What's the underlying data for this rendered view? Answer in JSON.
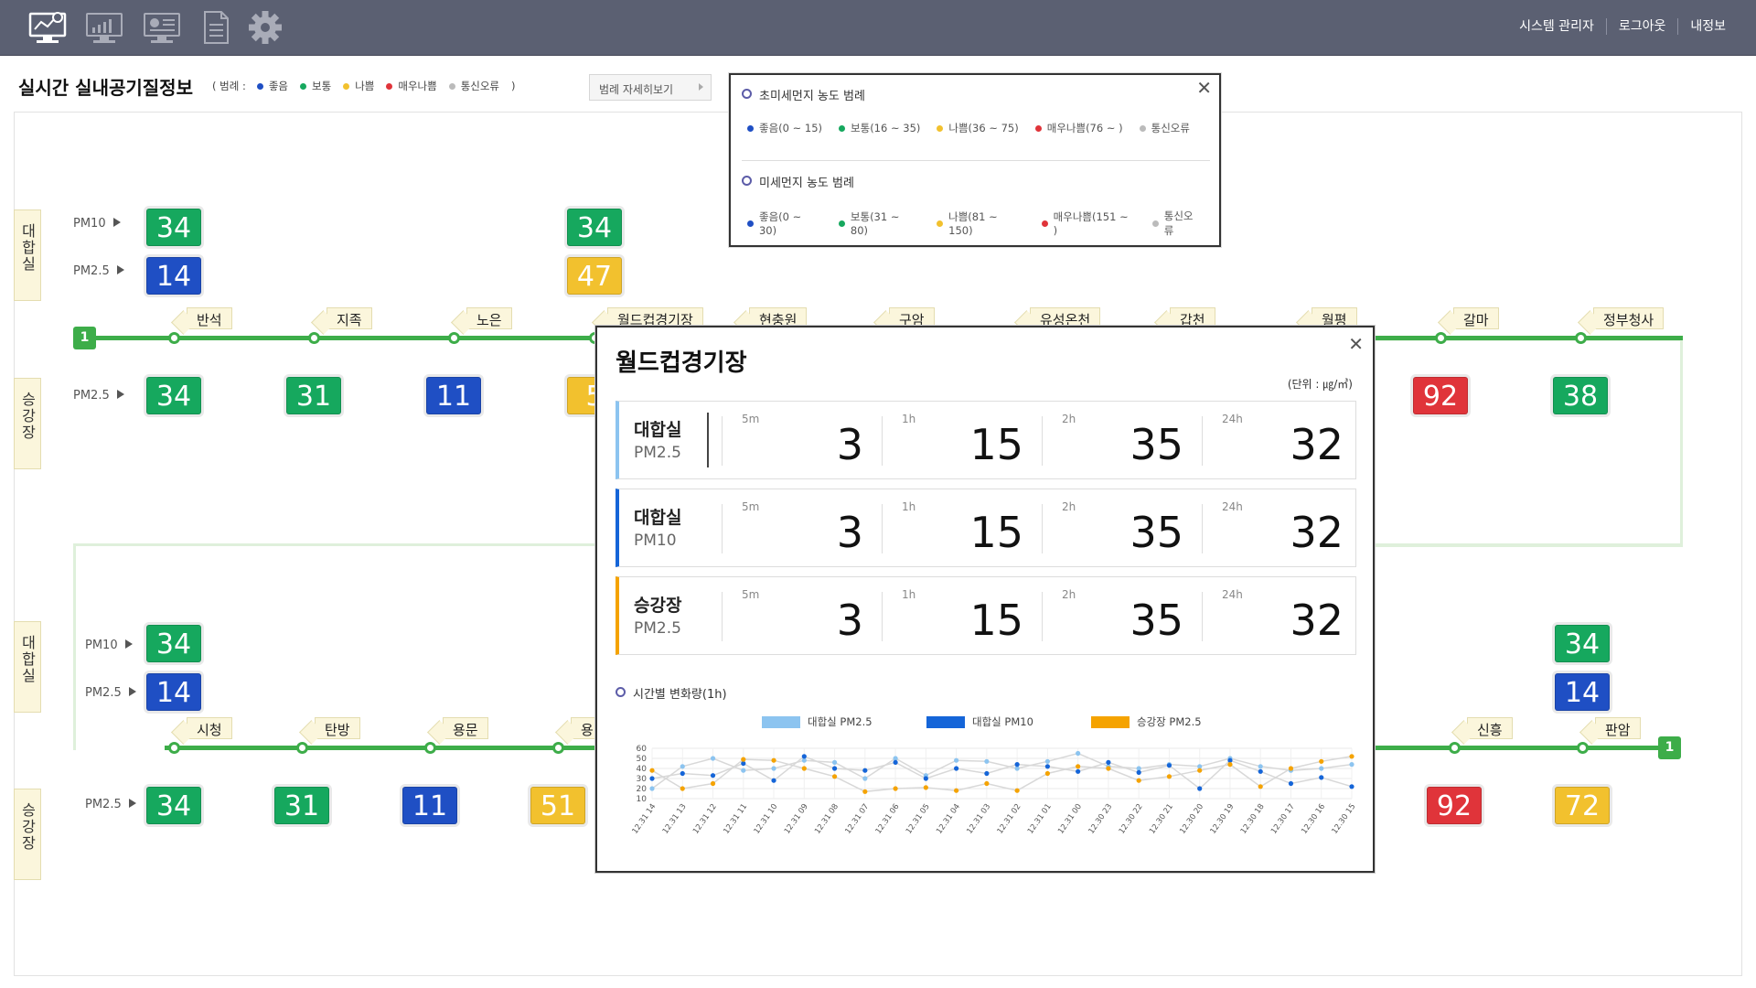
{
  "header": {
    "icons": [
      "monitor-dashboard-icon",
      "chart-monitor-icon",
      "presentation-monitor-icon",
      "document-icon",
      "gear-icon"
    ],
    "nav": [
      "시스템 관리자",
      "로그아웃",
      "내정보"
    ]
  },
  "page": {
    "title": "실시간 실내공기질정보",
    "legend_prefix": "( 범례 :",
    "legend_suffix": ")",
    "legend": [
      {
        "label": "좋음",
        "color": "#1f4fc4"
      },
      {
        "label": "보통",
        "color": "#16a85e"
      },
      {
        "label": "나쁨",
        "color": "#f2c12e"
      },
      {
        "label": "매우나쁨",
        "color": "#e0343a"
      },
      {
        "label": "통신오류",
        "color": "#bbbbbb"
      }
    ],
    "legend_button": "범례 자세히보기"
  },
  "side_tabs": {
    "daehapsil": "대합실",
    "seunggangjang": "승강장"
  },
  "row_labels": {
    "pm10": "PM10",
    "pm25": "PM2.5"
  },
  "line_number": "1",
  "upper_line": {
    "stations": [
      "반석",
      "지족",
      "노은",
      "월드컵경기장",
      "현충원",
      "구암",
      "유성온천",
      "갑천",
      "월평",
      "갈마",
      "정부청사"
    ],
    "concourse_pm10": [
      {
        "station": "반석",
        "value": "34",
        "color": "#16a85e"
      },
      {
        "station": "월드컵경기장",
        "value": "34",
        "color": "#16a85e"
      }
    ],
    "concourse_pm25": [
      {
        "station": "반석",
        "value": "14",
        "color": "#1f4fc4"
      },
      {
        "station": "월드컵경기장",
        "value": "47",
        "color": "#f2c12e"
      }
    ],
    "platform_pm25": [
      {
        "station": "반석",
        "value": "34",
        "color": "#16a85e"
      },
      {
        "station": "지족",
        "value": "31",
        "color": "#16a85e"
      },
      {
        "station": "노은",
        "value": "11",
        "color": "#1f4fc4"
      },
      {
        "station": "월드컵경기장",
        "value": "5",
        "color": "#f2c12e"
      },
      {
        "station": "갈마",
        "value": "92",
        "color": "#e0343a"
      },
      {
        "station": "정부청사",
        "value": "38",
        "color": "#16a85e"
      }
    ]
  },
  "lower_line": {
    "stations": [
      "시청",
      "탄방",
      "용문",
      "용",
      "신흥",
      "판암"
    ],
    "concourse_pm10": [
      {
        "station": "시청",
        "value": "34",
        "color": "#16a85e"
      },
      {
        "station": "판암",
        "value": "34",
        "color": "#16a85e"
      }
    ],
    "concourse_pm25": [
      {
        "station": "시청",
        "value": "14",
        "color": "#1f4fc4"
      },
      {
        "station": "판암",
        "value": "14",
        "color": "#1f4fc4"
      }
    ],
    "platform_pm25": [
      {
        "station": "시청",
        "value": "34",
        "color": "#16a85e"
      },
      {
        "station": "탄방",
        "value": "31",
        "color": "#16a85e"
      },
      {
        "station": "용문",
        "value": "11",
        "color": "#1f4fc4"
      },
      {
        "station": "용",
        "value": "51",
        "color": "#f2c12e"
      },
      {
        "station": "신흥",
        "value": "92",
        "color": "#e0343a"
      },
      {
        "station": "판암",
        "value": "72",
        "color": "#f2c12e"
      }
    ]
  },
  "legend_popup": {
    "pm25_title": "초미세먼지 농도 범례",
    "pm25_items": [
      {
        "label": "좋음(0 ~ 15)",
        "color": "#1f4fc4"
      },
      {
        "label": "보통(16 ~ 35)",
        "color": "#16a85e"
      },
      {
        "label": "나쁨(36 ~ 75)",
        "color": "#f2c12e"
      },
      {
        "label": "매우나쁨(76 ~ )",
        "color": "#e0343a"
      },
      {
        "label": "통신오류",
        "color": "#bbbbbb"
      }
    ],
    "pm10_title": "미세먼지 농도 범례",
    "pm10_items": [
      {
        "label": "좋음(0 ~ 30)",
        "color": "#1f4fc4"
      },
      {
        "label": "보통(31 ~ 80)",
        "color": "#16a85e"
      },
      {
        "label": "나쁨(81 ~ 150)",
        "color": "#f2c12e"
      },
      {
        "label": "매우나쁨(151 ~ )",
        "color": "#e0343a"
      },
      {
        "label": "통신오류",
        "color": "#bbbbbb"
      }
    ]
  },
  "detail_popup": {
    "title": "월드컵경기장",
    "unit": "(단위 : ㎍/㎥)",
    "periods": [
      "5m",
      "1h",
      "2h",
      "24h"
    ],
    "cards": [
      {
        "name": "대합실",
        "metric": "PM2.5",
        "accent": "#8cc4f0",
        "values": [
          "3",
          "15",
          "35",
          "32"
        ]
      },
      {
        "name": "대합실",
        "metric": "PM10",
        "accent": "#1565d8",
        "values": [
          "3",
          "15",
          "35",
          "32"
        ]
      },
      {
        "name": "승강장",
        "metric": "PM2.5",
        "accent": "#f5a300",
        "values": [
          "3",
          "15",
          "35",
          "32"
        ]
      }
    ],
    "chart_title": "시간별 변화량(1h)"
  },
  "chart_data": {
    "type": "line",
    "title": "시간별 변화량(1h)",
    "x": [
      "12.31 14",
      "12.31 13",
      "12.31 12",
      "12.31 11",
      "12.31 10",
      "12.31 09",
      "12.31 08",
      "12.31 07",
      "12.31 06",
      "12.31 05",
      "12.31 04",
      "12.31 03",
      "12.31 02",
      "12.31 01",
      "12.31 00",
      "12.30 23",
      "12.30 22",
      "12.30 21",
      "12.30 20",
      "12.30 19",
      "12.30 18",
      "12.30 17",
      "12.30 16",
      "12.30 15"
    ],
    "ylim": [
      10,
      60
    ],
    "yticks": [
      10,
      20,
      30,
      40,
      50,
      60
    ],
    "series": [
      {
        "name": "대합실 PM2.5",
        "color": "#8cc4f0",
        "values": [
          20,
          42,
          50,
          38,
          40,
          48,
          46,
          30,
          50,
          33,
          48,
          47,
          40,
          47,
          55,
          42,
          40,
          44,
          42,
          50,
          42,
          38,
          40,
          44
        ]
      },
      {
        "name": "대합실 PM10",
        "color": "#1565d8",
        "values": [
          30,
          35,
          33,
          45,
          28,
          52,
          40,
          38,
          46,
          30,
          40,
          35,
          44,
          42,
          37,
          46,
          36,
          43,
          20,
          48,
          37,
          25,
          31,
          22
        ]
      },
      {
        "name": "승강장 PM2.5",
        "color": "#f5a300",
        "values": [
          38,
          20,
          25,
          49,
          48,
          40,
          32,
          17,
          20,
          21,
          18,
          25,
          18,
          35,
          42,
          40,
          28,
          32,
          38,
          44,
          22,
          40,
          47,
          52
        ]
      }
    ],
    "grid": true,
    "legend": "top"
  }
}
